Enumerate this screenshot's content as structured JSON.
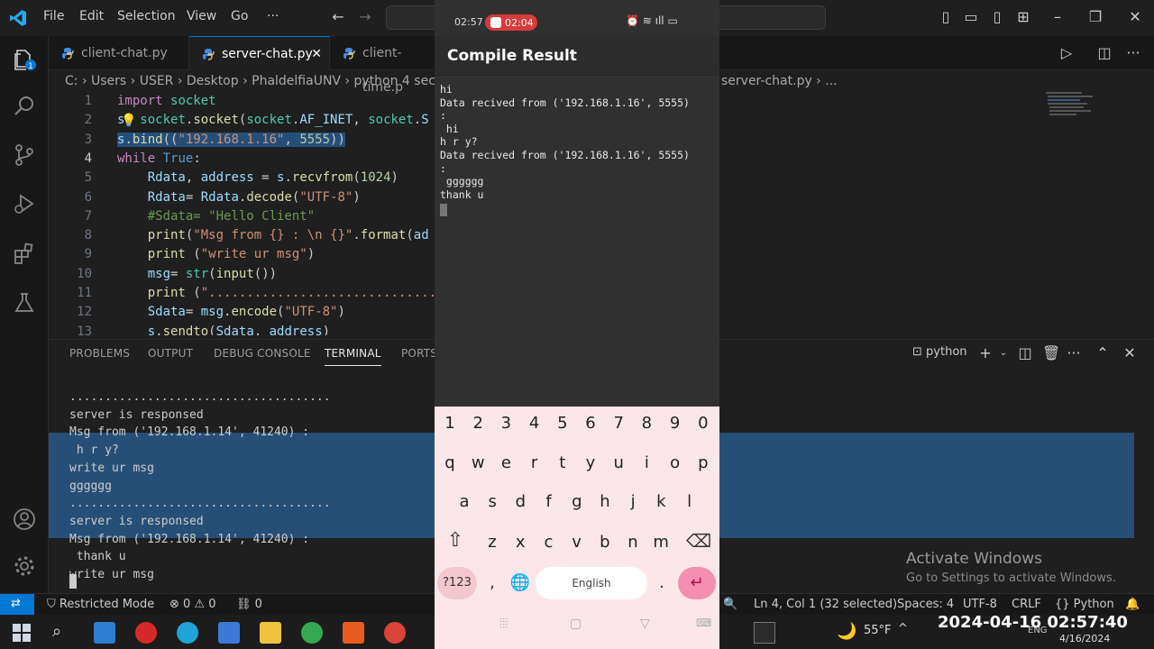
{
  "titlebar": {
    "menu": [
      "File",
      "Edit",
      "Selection",
      "View",
      "Go",
      "···"
    ]
  },
  "tabs": [
    {
      "label": "client-chat.py",
      "active": false
    },
    {
      "label": "server-chat.py",
      "active": true
    },
    {
      "label": "client-time.p",
      "active": false
    }
  ],
  "breadcrumb": {
    "path": "C: › Users › USER › Desktop › PhaldelfiaUNV › python 4 secu",
    "right": "server-chat.py › ..."
  },
  "editor": {
    "lines": [
      {
        "n": "1",
        "html": "<span class='kw'>import</span> <span class='cls'>socket</span>"
      },
      {
        "n": "2",
        "html": "<span class='var'>s</span>= <span class='cls'>socket</span>.<span class='fn'>socket</span>(<span class='cls'>socket</span>.<span class='var'>AF_INET</span>, <span class='cls'>socket</span>.<span class='var'>S</span>"
      },
      {
        "n": "3",
        "html": "<span class='sel'><span class='var'>s</span>.<span class='fn'>bind</span>((<span class='str'>\"192.168.1.16\"</span>, <span class='num'>5555</span>))</span>"
      },
      {
        "n": "4",
        "html": "<span class='kw'>while</span> <span class='kw2'>True</span>:"
      },
      {
        "n": "5",
        "html": "    <span class='var'>Rdata</span>, <span class='var'>address</span> = <span class='var'>s</span>.<span class='fn'>recvfrom</span>(<span class='num'>1024</span>)"
      },
      {
        "n": "6",
        "html": "    <span class='var'>Rdata</span>= <span class='var'>Rdata</span>.<span class='fn'>decode</span>(<span class='str'>\"UTF-8\"</span>)"
      },
      {
        "n": "7",
        "html": "    <span class='cmt'>#Sdata= \"Hello Client\"</span>"
      },
      {
        "n": "8",
        "html": "    <span class='fn'>print</span>(<span class='str'>\"Msg from {} : \\n {}\"</span>.<span class='fn'>format</span>(<span class='var'>ad</span>"
      },
      {
        "n": "9",
        "html": "    <span class='fn'>print</span> (<span class='str'>\"write ur msg\"</span>)"
      },
      {
        "n": "10",
        "html": "    <span class='var'>msg</span>= <span class='cls'>str</span>(<span class='fn'>input</span>())"
      },
      {
        "n": "11",
        "html": "    <span class='fn'>print</span> (<span class='str'>\"...............................</span>"
      },
      {
        "n": "12",
        "html": "    <span class='var'>Sdata</span>= <span class='var'>msg</span>.<span class='fn'>encode</span>(<span class='str'>\"UTF-8\"</span>)"
      },
      {
        "n": "13",
        "html": "    <span class='var'>s</span>.<span class='fn'>sendto</span>(<span class='var'>Sdata</span>, <span class='var'>address</span>)"
      }
    ],
    "current_line": "4"
  },
  "panel": {
    "tabs": [
      "PROBLEMS",
      "OUTPUT",
      "DEBUG CONSOLE",
      "TERMINAL",
      "PORTS"
    ],
    "active_tab": "TERMINAL",
    "terminal_name": "python"
  },
  "terminal": {
    "lines": [
      ".....................................",
      "server is responsed",
      "Msg from ('192.168.1.14', 41240) :",
      " h r y?",
      "write ur msg",
      "gggggg",
      ".....................................",
      "server is responsed",
      "Msg from ('192.168.1.14', 41240) :",
      " thank u",
      "write ur msg"
    ]
  },
  "activate_windows": {
    "title": "Activate Windows",
    "subtitle": "Go to Settings to activate Windows."
  },
  "statusbar": {
    "restricted": "Restricted Mode",
    "problems": "⊗ 0 ⚠ 0",
    "ports": "⛓ 0",
    "position": "Ln 4, Col 1 (32 selected)",
    "spaces": "Spaces: 4",
    "encoding": "UTF-8",
    "eol": "CRLF",
    "language": "{} Python"
  },
  "taskbar": {
    "weather": "55°F",
    "lang": "ENG",
    "date": "4/16/2024"
  },
  "overlay_clock": "2024-04-16  02:57:40",
  "phone": {
    "time": "02:57",
    "rec_time": "02:04",
    "title": "Compile Result",
    "output": [
      "hi",
      "Data recived from ('192.168.1.16', 5555)",
      ":",
      " hi",
      "h r y?",
      "Data recived from ('192.168.1.16', 5555)",
      ":",
      " gggggg",
      "thank u"
    ],
    "keyboard": {
      "row_numbers": [
        "1",
        "2",
        "3",
        "4",
        "5",
        "6",
        "7",
        "8",
        "9",
        "0"
      ],
      "row1": [
        "q",
        "w",
        "e",
        "r",
        "t",
        "y",
        "u",
        "i",
        "o",
        "p"
      ],
      "row2": [
        "a",
        "s",
        "d",
        "f",
        "g",
        "h",
        "j",
        "k",
        "l"
      ],
      "row3": [
        "z",
        "x",
        "c",
        "v",
        "b",
        "n",
        "m"
      ],
      "symbols": "?123",
      "comma": ",",
      "space": "English",
      "period": "."
    }
  },
  "colors": {
    "accent": "#0078d4",
    "selection": "#264f78",
    "keyboard_bg": "#fbe7ea",
    "enter_key": "#f48fb1"
  }
}
